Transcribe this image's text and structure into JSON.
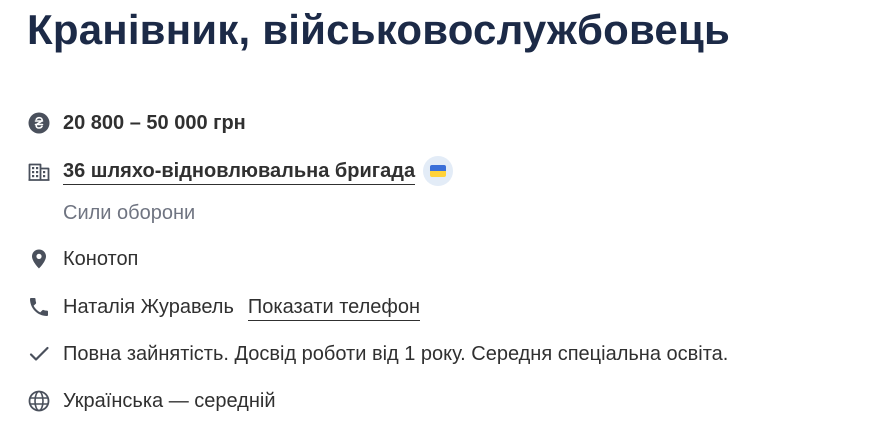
{
  "vacancy": {
    "title": "Кранівник, військовослужбовець"
  },
  "salary": {
    "text": "20 800 – 50 000 грн",
    "icon": "hryvnia-icon"
  },
  "company": {
    "name": "36 шляхо-відновлювальна бригада",
    "subtitle": "Сили оборони",
    "icon": "building-icon",
    "badge_icon": "ukraine-flag-icon"
  },
  "location": {
    "city": "Конотоп",
    "icon": "location-pin-icon"
  },
  "contact": {
    "name": "Наталія Журавель",
    "show_phone_label": "Показати телефон",
    "icon": "phone-icon"
  },
  "requirements": {
    "text": "Повна зайнятість. Досвід роботи від 1 року. Середня спеціальна освіта.",
    "icon": "checkmark-icon"
  },
  "language": {
    "text": "Українська — середній",
    "icon": "globe-icon"
  },
  "colors": {
    "title": "#1c2a47",
    "text": "#303030",
    "muted": "#6f7481",
    "icon": "#4a505c",
    "flag_blue": "#3b6fd8",
    "flag_yellow": "#ffd23a",
    "badge_bg": "#e3ecf7"
  }
}
